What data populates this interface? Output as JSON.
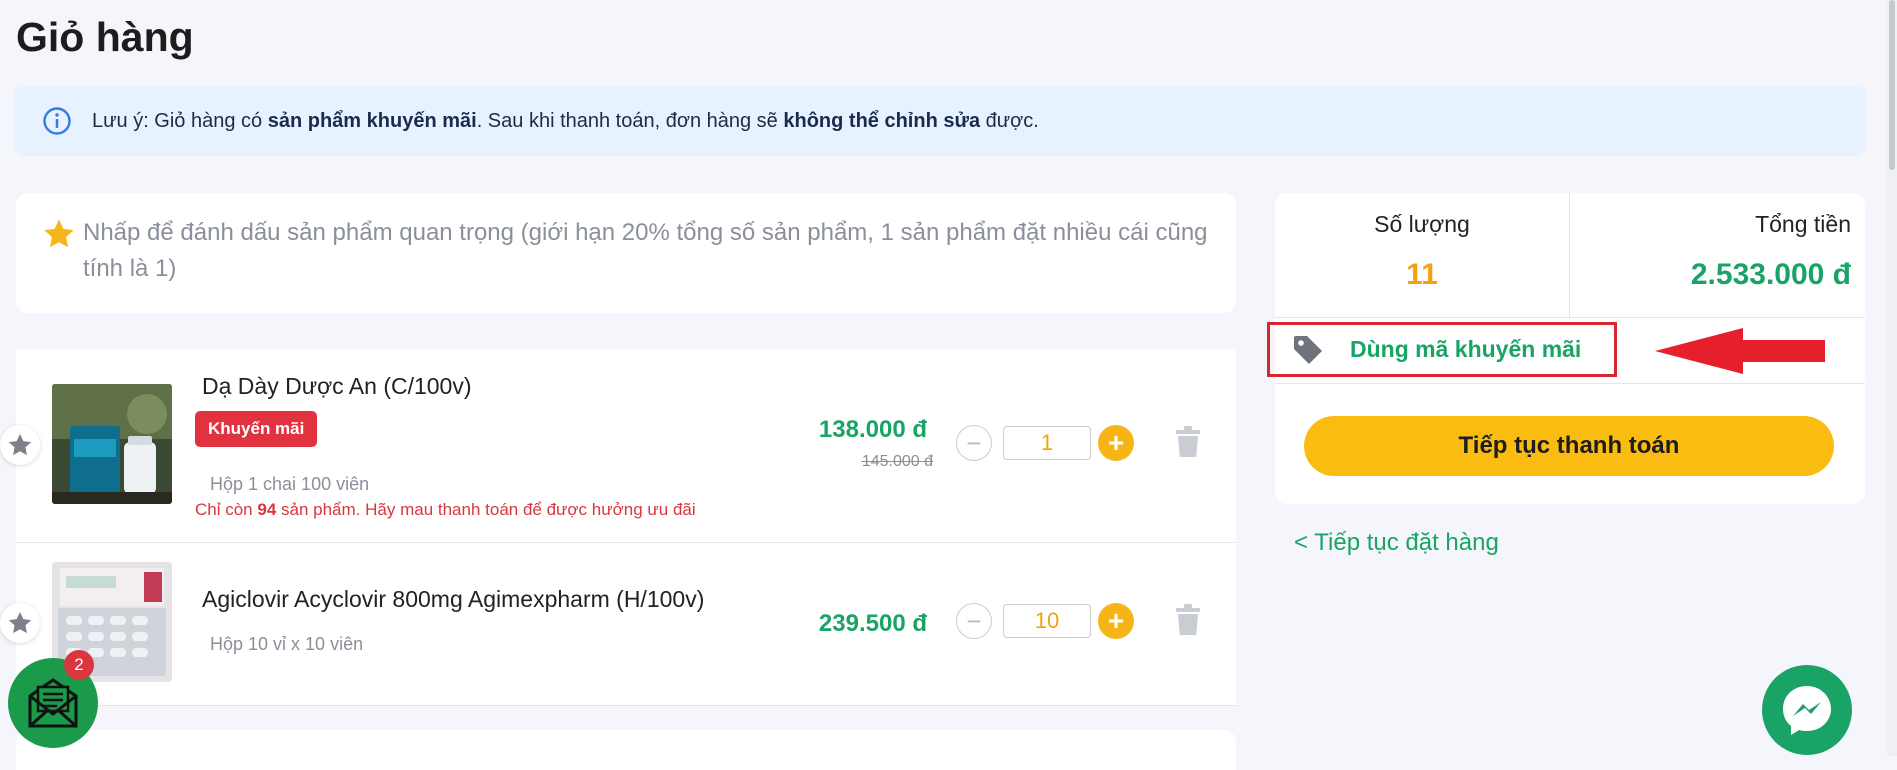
{
  "page": {
    "title": "Giỏ hàng"
  },
  "notice": {
    "prefix": "Lưu ý: Giỏ hàng có ",
    "bold1": "sản phẩm khuyến mãi",
    "middle": ". Sau khi thanh toán, đơn hàng sẽ ",
    "bold2": "không thể chỉnh sửa",
    "suffix": " được.",
    "icon": "info-icon"
  },
  "star_hint": {
    "text": "Nhấp để đánh dấu sản phẩm quan trọng (giới hạn 20% tổng số sản phẩm, 1 sản phẩm đặt nhiều cái cũng tính là 1)",
    "icon": "star-icon"
  },
  "items": [
    {
      "name": "Dạ Dày Dược An (C/100v)",
      "badge": "Khuyến mãi",
      "pack": "Hộp 1 chai 100 viên",
      "stock_prefix": "Chỉ còn ",
      "stock_count": "94",
      "stock_suffix": " sản phẩm. Hãy mau thanh toán để được hưởng ưu đãi",
      "price": "138.000 đ",
      "old_price": "145.000 đ",
      "qty": "1"
    },
    {
      "name": "Agiclovir Acyclovir 800mg Agimexpharm (H/100v)",
      "pack": "Hộp 10 vỉ x 10 viên",
      "price": "239.500 đ",
      "qty": "10"
    }
  ],
  "summary": {
    "qty_label": "Số lượng",
    "qty_value": "11",
    "total_label": "Tổng tiền",
    "total_value": "2.533.000 đ",
    "promo_label": "Dùng mã khuyến mãi",
    "checkout_label": "Tiếp tục thanh toán"
  },
  "continue_link": "< Tiếp tục đặt hàng",
  "mail_badge": "2",
  "colors": {
    "green": "#1aa367",
    "orange": "#f3a10f",
    "yellow_button": "#fbbc12",
    "red": "#d42731",
    "notice_bg": "#e7f1ff"
  }
}
